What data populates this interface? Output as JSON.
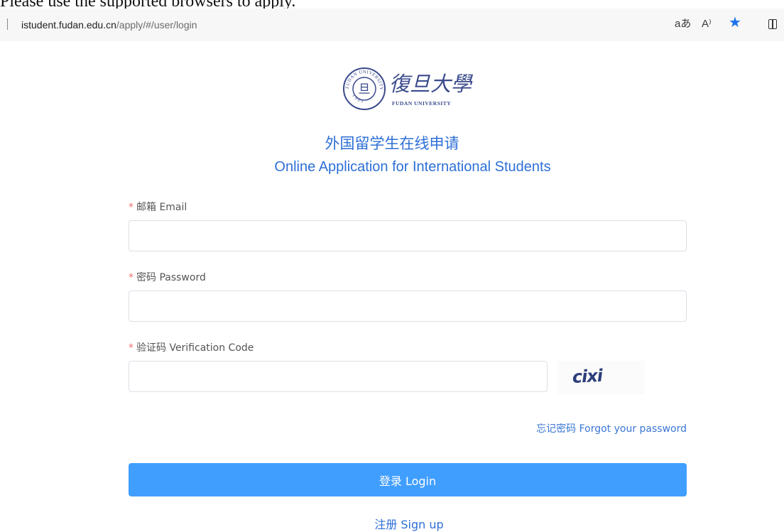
{
  "notice": "Please use the supported browsers to apply.",
  "browser": {
    "url_host": "istudent.fudan.edu.cn",
    "url_path": "/apply/#/user/login",
    "translate_icon": "aあ",
    "read_aloud_icon": "A⁾"
  },
  "logo": {
    "seal_text": "FUDAN UNIVERSITY",
    "seal_year": "1905",
    "seal_center": "旦",
    "name_cn": "復旦大學",
    "name_en": "FUDAN UNIVERSITY"
  },
  "heading": {
    "cn": "外国留学生在线申请",
    "en": "Online Application for International Students"
  },
  "form": {
    "required_mark": "*",
    "email_label": "邮箱 Email",
    "password_label": "密码 Password",
    "code_label": "验证码 Verification Code",
    "email_value": "",
    "password_value": "",
    "code_value": "",
    "captcha_text": "cixi",
    "forgot_link": "忘记密码 Forgot your password",
    "login_button": "登录 Login",
    "signup_link": "注册 Sign up"
  },
  "colors": {
    "accent": "#409eff",
    "heading_blue": "#2d6fd6",
    "required_red": "#f56c6c",
    "star_blue": "#1a73e8"
  }
}
